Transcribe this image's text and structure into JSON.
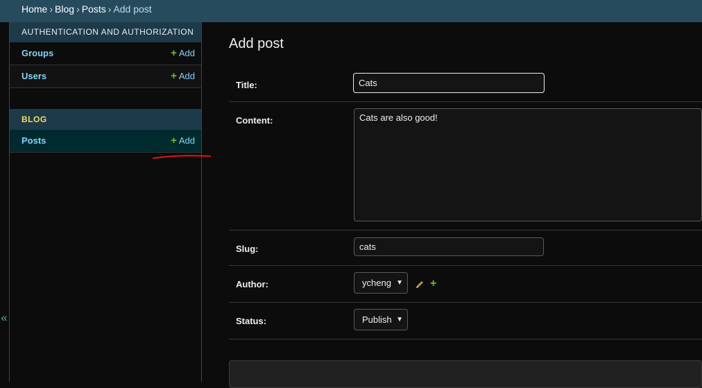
{
  "breadcrumbs": {
    "home": "Home",
    "app": "Blog",
    "model": "Posts",
    "current": "Add post",
    "separator": "›"
  },
  "sidebar": {
    "toggle_label": "«",
    "modules": [
      {
        "caption": "AUTHENTICATION AND AUTHORIZATION",
        "models": [
          {
            "name": "Groups",
            "add_label": "Add"
          },
          {
            "name": "Users",
            "add_label": "Add"
          }
        ]
      },
      {
        "caption": "BLOG",
        "models": [
          {
            "name": "Posts",
            "add_label": "Add"
          }
        ]
      }
    ],
    "add_icon": "plus-icon"
  },
  "form": {
    "title": "Add post",
    "fields": {
      "title": {
        "label": "Title:",
        "value": "Cats"
      },
      "content": {
        "label": "Content:",
        "value": "Cats are also good!"
      },
      "slug": {
        "label": "Slug:",
        "value": "cats"
      },
      "author": {
        "label": "Author:",
        "value": "ycheng",
        "edit_icon": "pencil-icon",
        "add_icon": "plus-icon"
      },
      "status": {
        "label": "Status:",
        "value": "Publish"
      }
    }
  },
  "colors": {
    "header_bg": "#264b5d",
    "module_caption_bg": "#1c3a49",
    "link": "#81d4fa",
    "add_green": "#70bf2b",
    "annotation_red": "#e0141e",
    "page_bg": "#0c0c0c"
  }
}
